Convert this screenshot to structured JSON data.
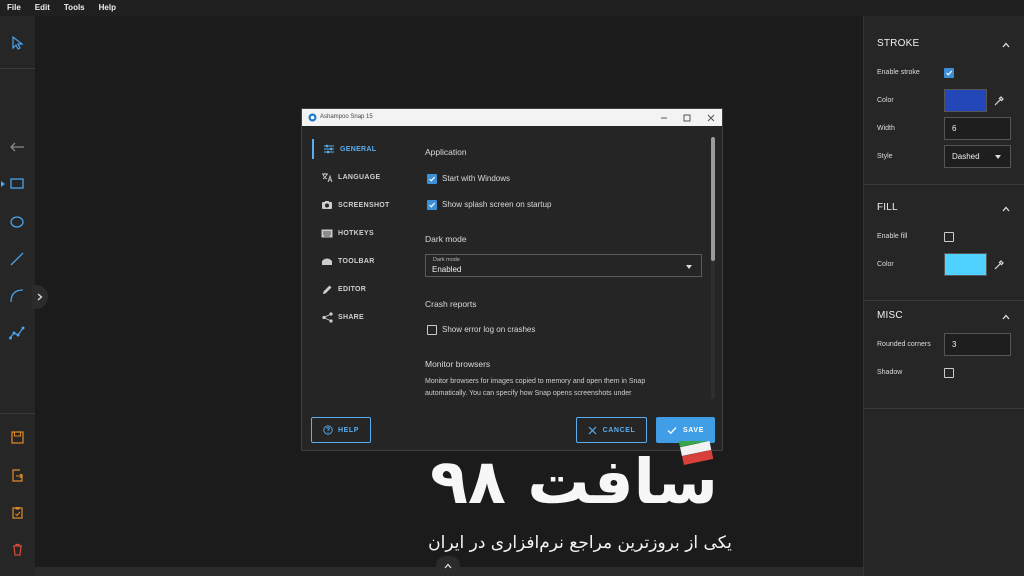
{
  "menu": [
    "File",
    "Edit",
    "Tools",
    "Help"
  ],
  "tools": [
    "select-tool",
    "arrow-tool",
    "rectangle-tool",
    "ellipse-tool",
    "line-tool",
    "curve-tool",
    "polyline-tool",
    "save-tool",
    "export-tool",
    "copy-tool",
    "delete-tool"
  ],
  "stroke": {
    "title": "STROKE",
    "enable_label": "Enable stroke",
    "enabled": true,
    "color_label": "Color",
    "color": "#2346b8",
    "width_label": "Width",
    "width": "6",
    "style_label": "Style",
    "style": "Dashed"
  },
  "fill": {
    "title": "FILL",
    "enable_label": "Enable fill",
    "enabled": false,
    "color_label": "Color",
    "color": "#4fd2ff"
  },
  "misc": {
    "title": "MISC",
    "rounded_label": "Rounded corners",
    "rounded": "3",
    "shadow_label": "Shadow",
    "shadow": false
  },
  "dialog": {
    "title": "Ashampoo Snap 15",
    "nav": [
      "GENERAL",
      "LANGUAGE",
      "SCREENSHOT",
      "HOTKEYS",
      "TOOLBAR",
      "EDITOR",
      "SHARE"
    ],
    "active_nav": "GENERAL",
    "application_heading": "Application",
    "start_windows": "Start with Windows",
    "splash": "Show splash screen on startup",
    "dark_heading": "Dark mode",
    "dark_field_label": "Dark mode",
    "dark_value": "Enabled",
    "crash_heading": "Crash reports",
    "error_log": "Show error log on crashes",
    "monitor_heading": "Monitor browsers",
    "monitor_desc_1": "Monitor browsers for images copied to memory and open them in Snap",
    "monitor_desc_2": "automatically. You can specify how Snap opens screenshots under",
    "help_label": "HELP",
    "cancel_label": "CANCEL",
    "save_label": "SAVE"
  },
  "watermark": {
    "title": "سافت ۹۸",
    "subtitle": "یکی از بروزترین مراجع نرم‌افزاری در ایران"
  }
}
